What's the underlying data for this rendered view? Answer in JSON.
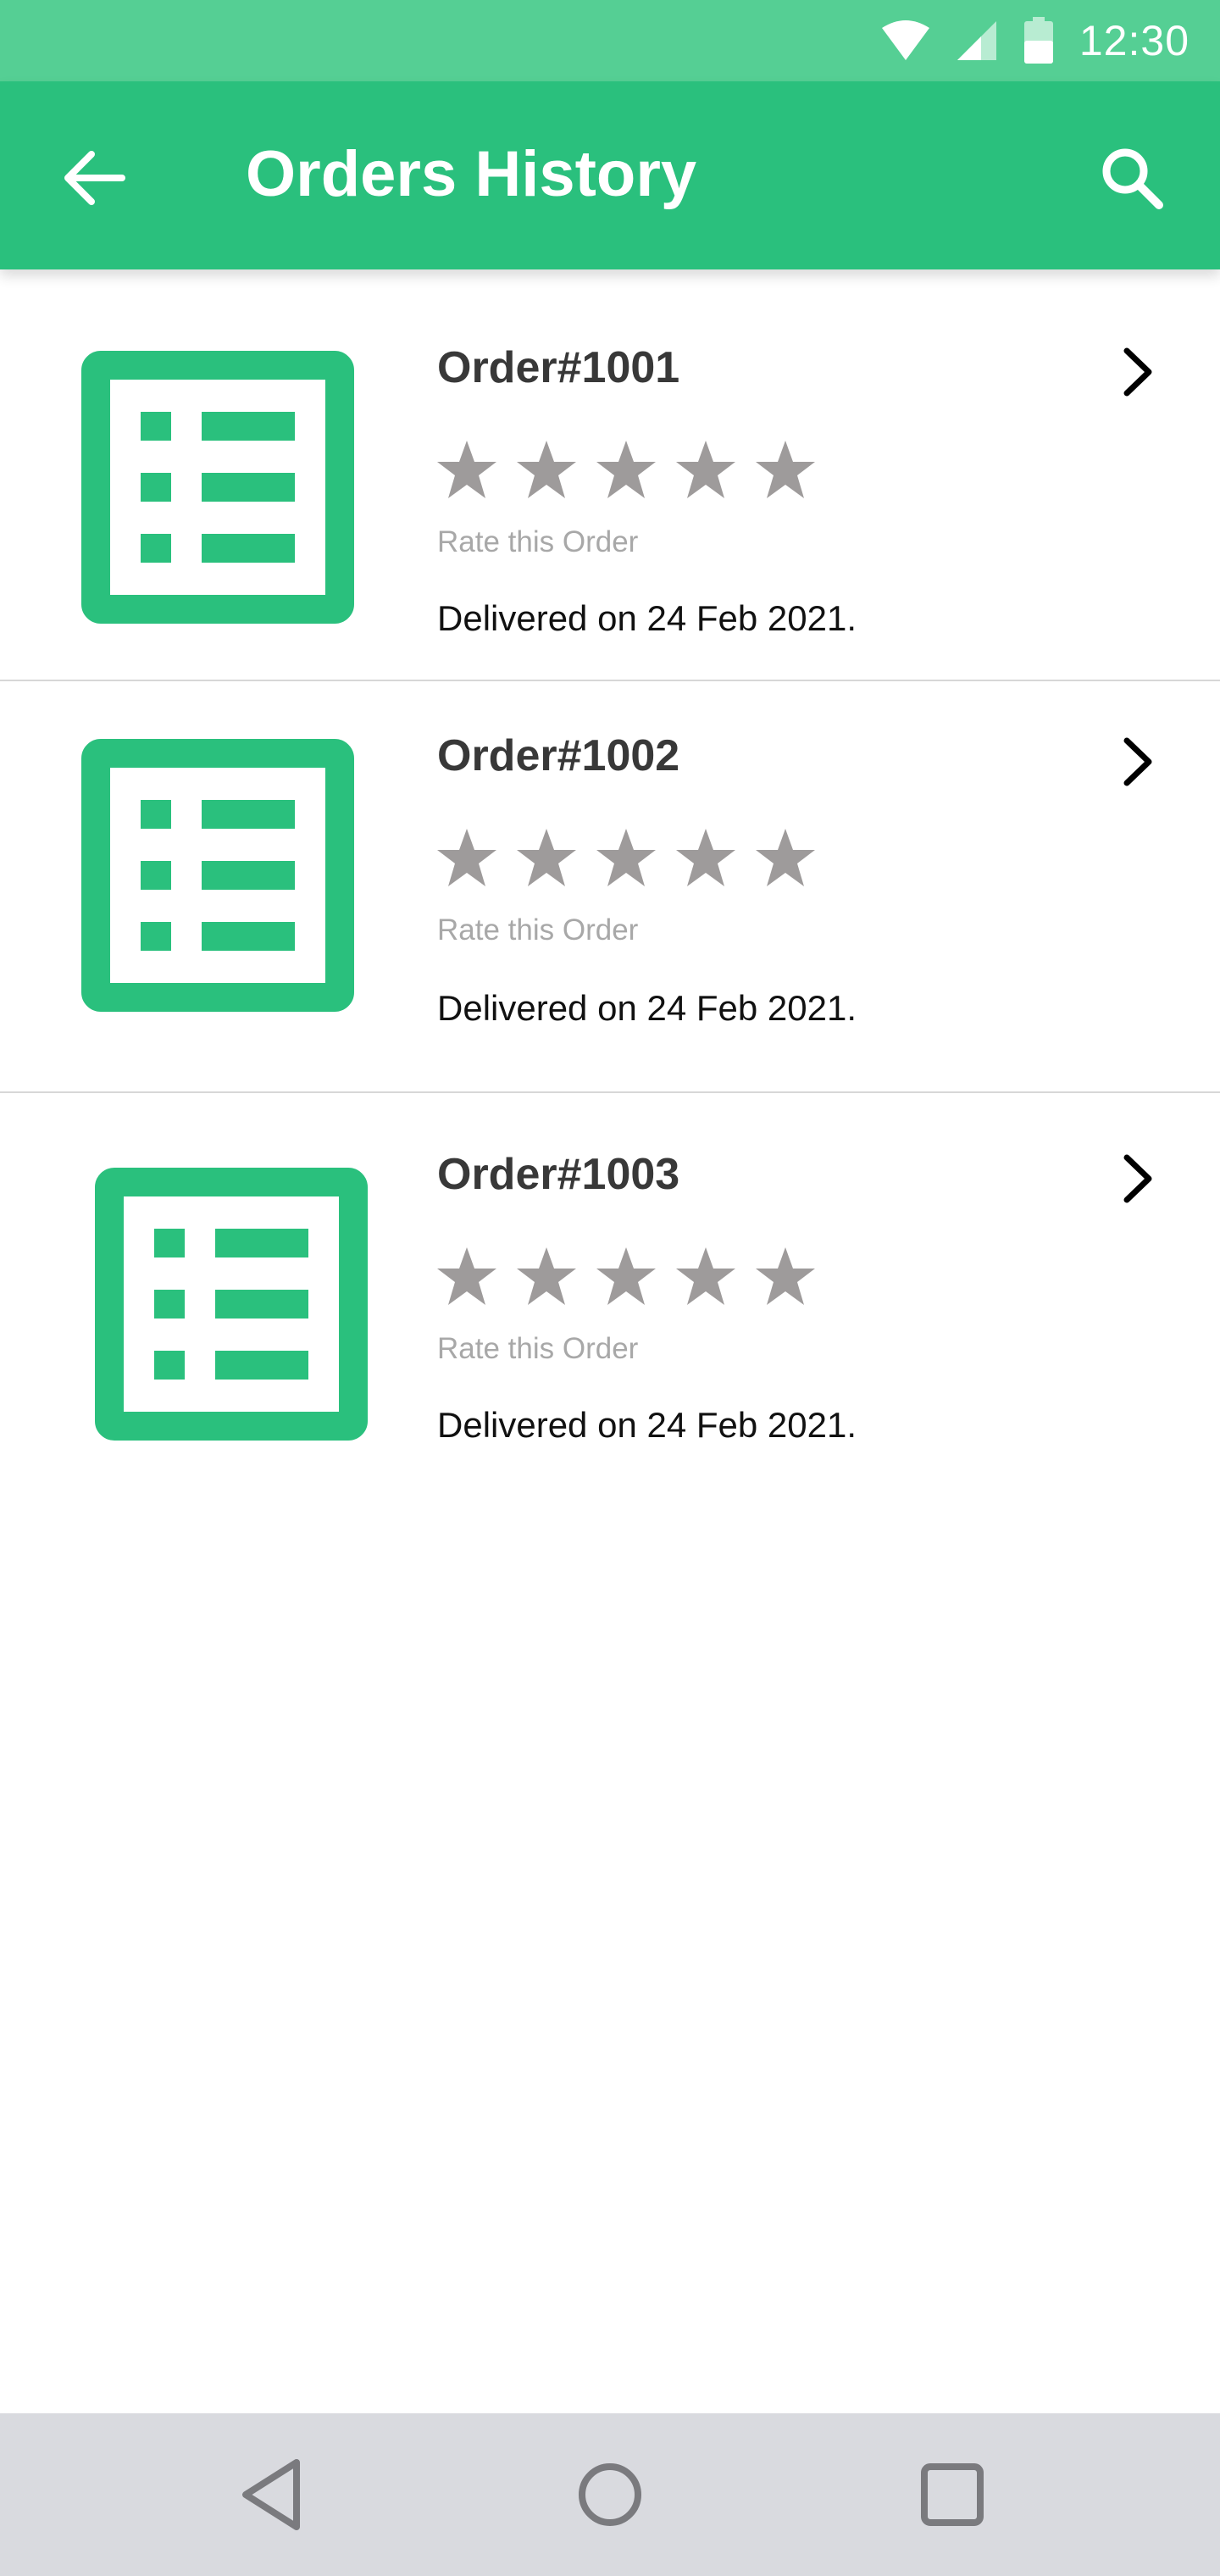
{
  "status_bar": {
    "time": "12:30",
    "icons": [
      "wifi-icon",
      "cell-signal-icon",
      "battery-icon"
    ],
    "background": "#55cf94"
  },
  "app_bar": {
    "title": "Orders History",
    "back_icon": "arrow-left-icon",
    "search_icon": "search-icon",
    "background": "#2ac07d"
  },
  "orders": [
    {
      "title": "Order#1001",
      "rating": 0,
      "max_rating": 5,
      "rate_label": "Rate this Order",
      "delivered": "Delivered on 24 Feb 2021."
    },
    {
      "title": "Order#1002",
      "rating": 0,
      "max_rating": 5,
      "rate_label": "Rate this Order",
      "delivered": "Delivered on 24 Feb 2021."
    },
    {
      "title": "Order#1003",
      "rating": 0,
      "max_rating": 5,
      "rate_label": "Rate this Order",
      "delivered": "Delivered on 24 Feb 2021."
    }
  ],
  "colors": {
    "accent": "#2ac07d",
    "star_empty": "#9e9b9b",
    "divider": "#d7d7d7",
    "nav_bar": "#d9dadf"
  },
  "nav_bar": {
    "icons": [
      "nav-back-icon",
      "nav-home-icon",
      "nav-recents-icon"
    ]
  }
}
